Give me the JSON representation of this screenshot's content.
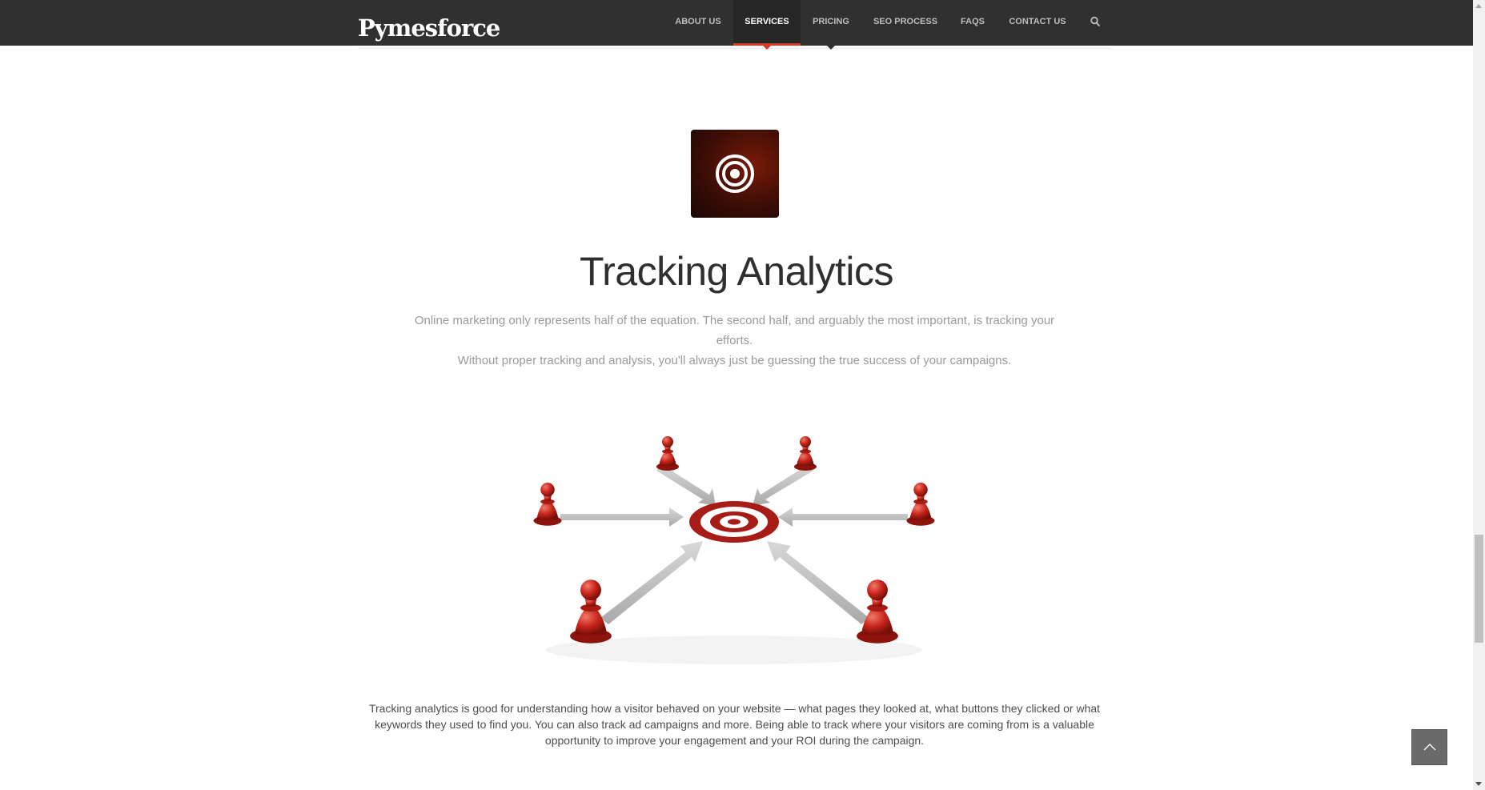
{
  "header": {
    "logo_text": "Pymesforce",
    "nav": [
      {
        "label": "ABOUT US"
      },
      {
        "label": "SERVICES"
      },
      {
        "label": "PRICING"
      },
      {
        "label": "SEO PROCESS"
      },
      {
        "label": "FAQS"
      },
      {
        "label": "CONTACT US"
      }
    ],
    "active_nav": "SERVICES",
    "search_icon": "search-icon"
  },
  "section": {
    "icon": "target-icon",
    "title": "Tracking Analytics",
    "subtitle_line1": "Online marketing only represents half of the equation. The second half, and arguably the most important, is tracking your efforts.",
    "subtitle_line2": "Without proper tracking and analysis, you'll always just be guessing the true success of your campaigns.",
    "illustration": "target-with-pawns-illustration",
    "body": "Tracking analytics is good for understanding how a visitor behaved on your website — what pages they looked at, what buttons they clicked or what keywords they used to find you. You can also track ad campaigns and more. Being able to track where your visitors are coming from is a valuable opportunity to improve your engagement and your ROI during the campaign."
  },
  "back_to_top_icon": "chevron-up-icon",
  "colors": {
    "nav_bg": "#303030",
    "accent": "#d43b26",
    "icon_box": "#3c0d05",
    "title": "#2f2f2f",
    "subtitle": "#9a9a9a"
  }
}
